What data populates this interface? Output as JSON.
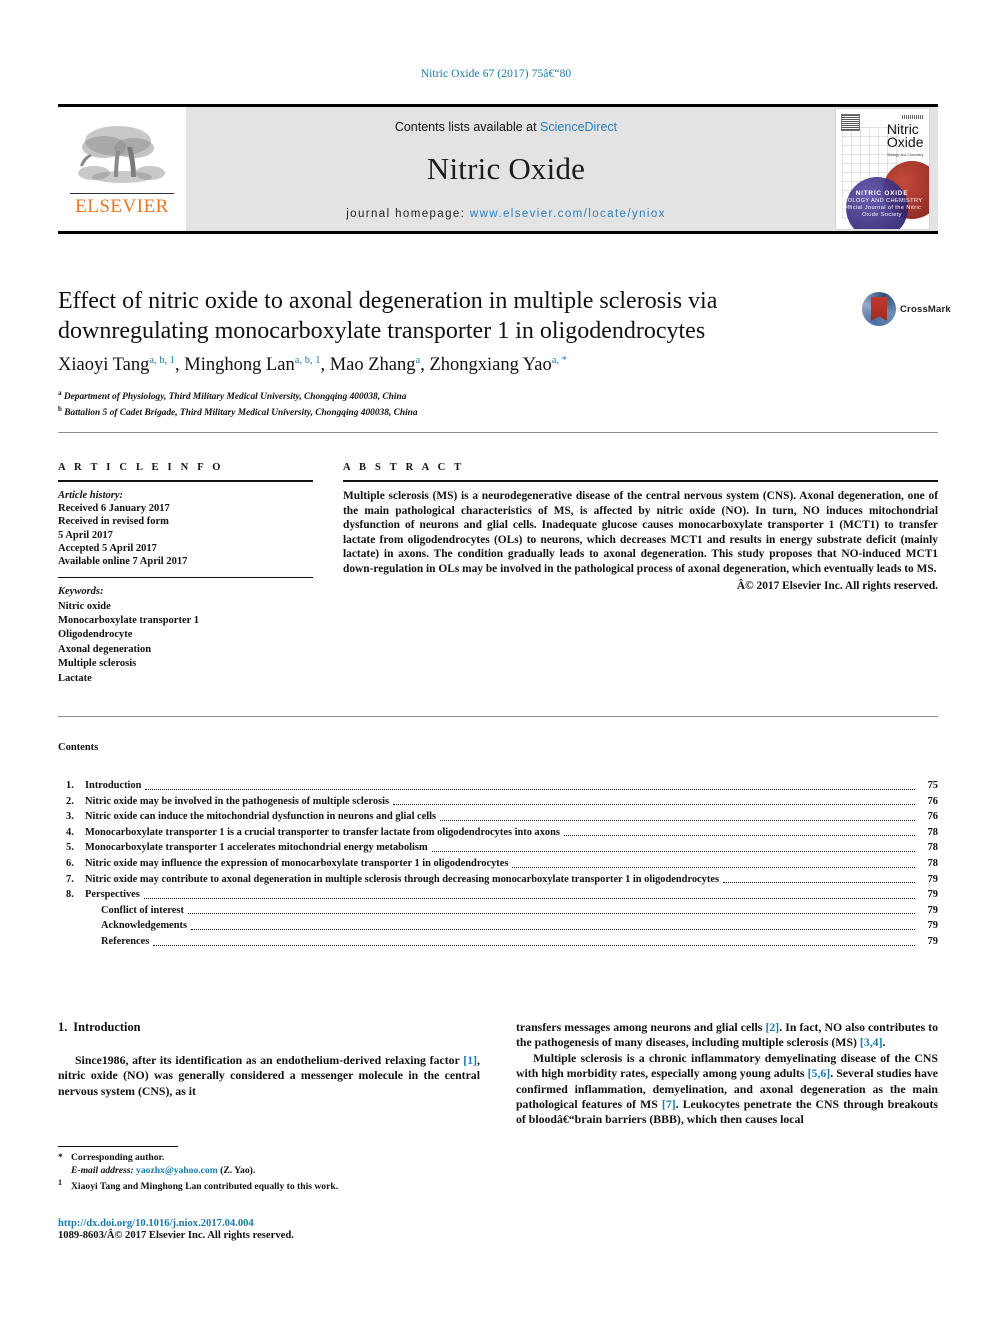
{
  "running_head": "Nitric Oxide 67 (2017) 75â€“80",
  "masthead": {
    "contents_prefix": "Contents lists available at ",
    "sciencedirect": "ScienceDirect",
    "journal_name": "Nitric Oxide",
    "homepage_prefix": "journal homepage: ",
    "homepage_url": "www.elsevier.com/locate/yniox",
    "publisher_logo_text": "ELSEVIER",
    "cover": {
      "title_line1": "Nitric",
      "title_line2": "Oxide",
      "subtitle": "Biology and Chemistry",
      "footer_title": "NITRIC OXIDE",
      "footer_sub": "BIOLOGY AND CHEMISTRY",
      "footer_sub2": "Official Journal of the Nitric Oxide Society"
    }
  },
  "article": {
    "title": "Effect of nitric oxide to axonal degeneration in multiple sclerosis via downregulating monocarboxylate transporter 1 in oligodendrocytes",
    "crossmark_label": "CrossMark",
    "authors": [
      {
        "name": "Xiaoyi Tang",
        "sup": "a, b, 1"
      },
      {
        "name": "Minghong Lan",
        "sup": "a, b, 1"
      },
      {
        "name": "Mao Zhang",
        "sup": "a"
      },
      {
        "name": "Zhongxiang Yao",
        "sup": "a, *"
      }
    ],
    "affiliations": [
      {
        "mark": "a",
        "text": "Department of Physiology, Third Military Medical University, Chongqing 400038, China"
      },
      {
        "mark": "b",
        "text": "Battalion 5 of Cadet Brigade, Third Military Medical University, Chongqing 400038, China"
      }
    ]
  },
  "article_info": {
    "heading": "A R T I C L E   I N F O",
    "history_label": "Article history:",
    "history": [
      "Received 6 January 2017",
      "Received in revised form",
      "5 April 2017",
      "Accepted 5 April 2017",
      "Available online 7 April 2017"
    ],
    "keywords_label": "Keywords:",
    "keywords": [
      "Nitric oxide",
      "Monocarboxylate transporter 1",
      "Oligodendrocyte",
      "Axonal degeneration",
      "Multiple sclerosis",
      "Lactate"
    ]
  },
  "abstract": {
    "heading": "A B S T R A C T",
    "text": "Multiple sclerosis (MS) is a neurodegenerative disease of the central nervous system (CNS). Axonal degeneration, one of the main pathological characteristics of MS, is affected by nitric oxide (NO). In turn, NO induces mitochondrial dysfunction of neurons and glial cells. Inadequate glucose causes monocarboxylate transporter 1 (MCT1) to transfer lactate from oligodendrocytes (OLs) to neurons, which decreases MCT1 and results in energy substrate deficit (mainly lactate) in axons. The condition gradually leads to axonal degeneration. This study proposes that NO-induced MCT1 down-regulation in OLs may be involved in the pathological process of axonal degeneration, which eventually leads to MS.",
    "copyright": "Â© 2017 Elsevier Inc. All rights reserved."
  },
  "contents": {
    "heading": "Contents",
    "items": [
      {
        "num": "1.",
        "label": "Introduction",
        "page": "75",
        "indent": false
      },
      {
        "num": "2.",
        "label": "Nitric oxide may be involved in the pathogenesis of multiple sclerosis",
        "page": "76",
        "indent": false
      },
      {
        "num": "3.",
        "label": "Nitric oxide can induce the mitochondrial dysfunction in neurons and glial cells",
        "page": "76",
        "indent": false
      },
      {
        "num": "4.",
        "label": "Monocarboxylate transporter 1 is a crucial transporter to transfer lactate from oligodendrocytes into axons",
        "page": "78",
        "indent": false
      },
      {
        "num": "5.",
        "label": "Monocarboxylate transporter 1 accelerates mitochondrial energy metabolism",
        "page": "78",
        "indent": false
      },
      {
        "num": "6.",
        "label": "Nitric oxide may influence the expression of monocarboxylate transporter 1 in oligodendrocytes",
        "page": "78",
        "indent": false
      },
      {
        "num": "7.",
        "label": "Nitric oxide may contribute to axonal degeneration in multiple sclerosis through decreasing monocarboxylate transporter 1 in oligodendrocytes",
        "page": "79",
        "indent": false
      },
      {
        "num": "8.",
        "label": "Perspectives",
        "page": "79",
        "indent": false
      },
      {
        "num": "",
        "label": "Conflict of interest",
        "page": "79",
        "indent": true
      },
      {
        "num": "",
        "label": "Acknowledgements",
        "page": "79",
        "indent": true
      },
      {
        "num": "",
        "label": "References",
        "page": "79",
        "indent": true
      }
    ]
  },
  "body": {
    "section_number": "1.",
    "section_title": "Introduction",
    "left_paragraph_pre": "Since1986, after its identification as an endothelium-derived relaxing factor ",
    "left_ref1": "[1]",
    "left_paragraph_post": ", nitric oxide (NO) was generally considered a messenger molecule in the central nervous system (CNS), as it",
    "right_p1_a": "transfers messages among neurons and glial cells ",
    "right_ref2": "[2]",
    "right_p1_b": ". In fact, NO also contributes to the pathogenesis of many diseases, including multiple sclerosis (MS) ",
    "right_ref34": "[3,4]",
    "right_p1_c": ".",
    "right_p2_a": "Multiple sclerosis is a chronic inflammatory demyelinating disease of the CNS with high morbidity rates, especially among young adults ",
    "right_ref56": "[5,6]",
    "right_p2_b": ". Several studies have confirmed inflammation, demyelination, and axonal degeneration as the main pathological features of MS ",
    "right_ref7": "[7]",
    "right_p2_c": ". Leukocytes penetrate the CNS through breakouts of bloodâ€“brain barriers (BBB), which then causes local"
  },
  "footnotes": {
    "corresponding": "Corresponding author.",
    "email_label": "E-mail address:",
    "email": "yaozhx@yahoo.com",
    "email_suffix": "(Z. Yao).",
    "equal_contrib": "Xiaoyi Tang and Minghong Lan contributed equally to this work.",
    "doi": "http://dx.doi.org/10.1016/j.niox.2017.04.004",
    "issn_line": "1089-8603/Â© 2017 Elsevier Inc. All rights reserved."
  },
  "colors": {
    "link_blue": "#1a7aa8",
    "sciencedirect_blue": "#2a7fbf",
    "elsevier_orange": "#E87722",
    "masthead_gray": "#e3e3e3"
  }
}
